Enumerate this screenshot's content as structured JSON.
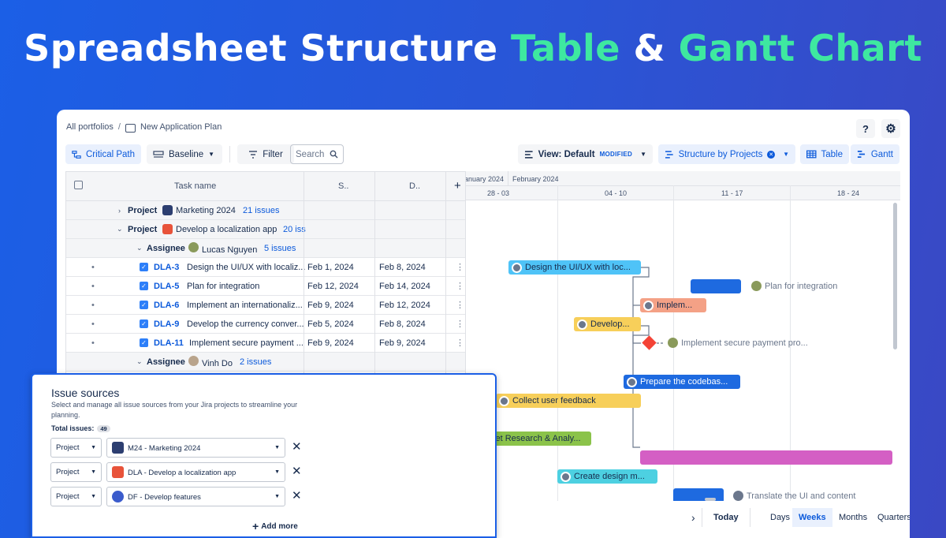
{
  "hero": {
    "part1": "Spreadsheet Structure ",
    "part2": "Table",
    "part3": " & ",
    "part4": "Gantt Chart"
  },
  "breadcrumb": {
    "root": "All portfolios",
    "sep": "/",
    "plan": "New Application Plan"
  },
  "top_icons": {
    "help": "?",
    "settings": "⚙"
  },
  "toolbar": {
    "critical_path": "Critical Path",
    "baseline": "Baseline",
    "filter": "Filter",
    "search_placeholder": "Search",
    "view_label": "View: Default",
    "view_badge": "MODIFIED",
    "structure": "Structure by Projects",
    "table": "Table",
    "gantt": "Gantt"
  },
  "grid": {
    "headers": {
      "task": "Task name",
      "start": "S..",
      "due": "D..",
      "add": "+"
    },
    "groups": [
      {
        "type": "Project",
        "name": "Marketing 2024",
        "count": "21 issues"
      },
      {
        "type": "Project",
        "name": "Develop a localization app",
        "count": "20 iss"
      },
      {
        "type": "Assignee",
        "name": "Lucas Nguyen",
        "count": "5 issues"
      },
      {
        "type": "Assignee",
        "name": "Vinh Do",
        "count": "2 issues"
      }
    ],
    "rows": [
      {
        "key": "DLA-3",
        "summary": "Design the UI/UX with localiz...",
        "start": "Feb 1, 2024",
        "due": "Feb 8, 2024"
      },
      {
        "key": "DLA-5",
        "summary": "Plan for integration",
        "start": "Feb 12, 2024",
        "due": "Feb 14, 2024"
      },
      {
        "key": "DLA-6",
        "summary": "Implement an internationaliz...",
        "start": "Feb 9, 2024",
        "due": "Feb 12, 2024"
      },
      {
        "key": "DLA-9",
        "summary": "Develop the currency conver...",
        "start": "Feb 5, 2024",
        "due": "Feb 8, 2024"
      },
      {
        "key": "DLA-11",
        "summary": "Implement secure payment ...",
        "start": "Feb 9, 2024",
        "due": "Feb 9, 2024"
      }
    ]
  },
  "gantt": {
    "months": [
      "anuary 2024",
      "February 2024"
    ],
    "weeks": [
      "28 - 03",
      "04 - 10",
      "11 - 17",
      "18 - 24"
    ],
    "bars": {
      "b1": "Design the UI/UX with loc...",
      "b3": "Implem...",
      "b4": "Develop...",
      "b6": "Prepare the codebas...",
      "b7": "Collect user feedback",
      "b8": "ket Research & Analy...",
      "b10": "Create design m..."
    },
    "labels": {
      "l2": "Plan for integration",
      "l5": "Implement secure payment pro...",
      "l11": "Translate the UI and content"
    },
    "colors": {
      "blue": "#2d7ff9",
      "cyan": "#4fc3f7",
      "salmon": "#f4a186",
      "yellow": "#f7cf5a",
      "green": "#8bc34a",
      "magenta": "#d45fc4",
      "teal": "#4dd0e1",
      "diamond": "#f44336"
    },
    "footer": {
      "chevron": "›",
      "today": "Today",
      "days": "Days",
      "weeks": "Weeks",
      "months": "Months",
      "quarters": "Quarters"
    }
  },
  "panel": {
    "title": "Issue sources",
    "desc": "Select and manage all issue sources from your Jira projects to streamline your planning.",
    "total_label": "Total issues:",
    "total_count": "49",
    "sources": [
      {
        "type": "Project",
        "name": "M24 - Marketing 2024"
      },
      {
        "type": "Project",
        "name": "DLA - Develop a localization app"
      },
      {
        "type": "Project",
        "name": "DF - Develop features"
      }
    ],
    "add_more": "Add more"
  }
}
